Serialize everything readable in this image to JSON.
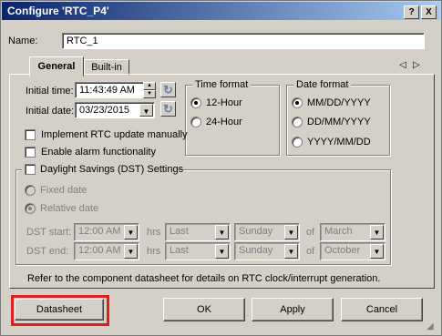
{
  "window": {
    "title": "Configure 'RTC_P4'",
    "help_btn": "?",
    "close_btn": "X"
  },
  "name": {
    "label": "Name:",
    "value": "RTC_1"
  },
  "tabs": [
    {
      "label": "General"
    },
    {
      "label": "Built-in"
    }
  ],
  "tab_nav": {
    "left": "◁",
    "right": "▷"
  },
  "initial_time": {
    "label": "Initial time:",
    "value": "11:43:49 AM"
  },
  "initial_date": {
    "label": "Initial date:",
    "value": "03/23/2015"
  },
  "time_format": {
    "title": "Time format",
    "options": [
      "12-Hour",
      "24-Hour"
    ],
    "selected": "12-Hour"
  },
  "date_format": {
    "title": "Date format",
    "options": [
      "MM/DD/YYYY",
      "DD/MM/YYYY",
      "YYYY/MM/DD"
    ],
    "selected": "MM/DD/YYYY"
  },
  "checks": {
    "rtc_manual": "Implement RTC update manually",
    "alarm": "Enable alarm functionality",
    "dst": "Daylight Savings (DST) Settings"
  },
  "dst": {
    "fixed": "Fixed date",
    "relative": "Relative date",
    "start": {
      "label": "DST start:",
      "time": "12:00 AM",
      "hrs": "hrs",
      "week": "Last",
      "day": "Sunday",
      "of": "of",
      "month": "March"
    },
    "end": {
      "label": "DST end:",
      "time": "12:00 AM",
      "hrs": "hrs",
      "week": "Last",
      "day": "Sunday",
      "of": "of",
      "month": "October"
    }
  },
  "footer_note": "Refer to the component datasheet for details on RTC clock/interrupt generation.",
  "buttons": {
    "datasheet": "Datasheet",
    "ok": "OK",
    "apply": "Apply",
    "cancel": "Cancel"
  },
  "colors": {
    "highlight": "#e0201e",
    "titlebar": "#0a246a"
  }
}
